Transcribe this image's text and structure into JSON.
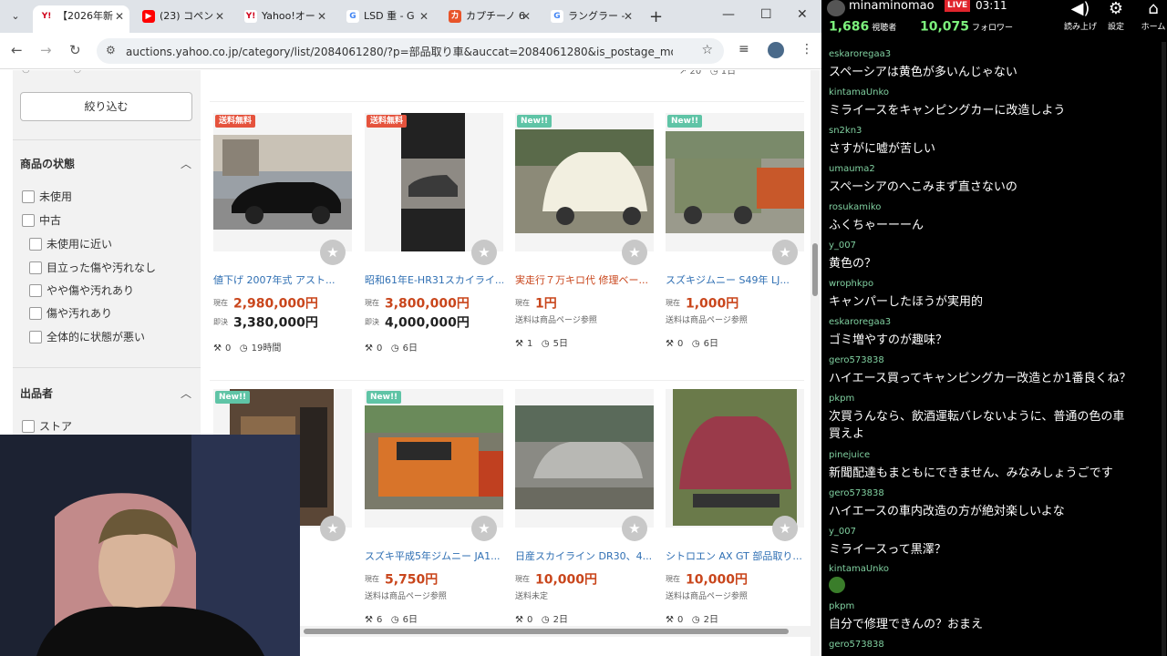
{
  "browser": {
    "tabs": [
      {
        "label": "【2026年新",
        "favicon": "Y!",
        "color": "#d0021b",
        "active": true
      },
      {
        "label": "(23) コペン",
        "favicon": "▶",
        "color": "#ff0000",
        "active": false
      },
      {
        "label": "Yahoo!オー",
        "favicon": "Y!",
        "color": "#d0021b",
        "active": false
      },
      {
        "label": "LSD 重 - G",
        "favicon": "G",
        "color": "#4285f4",
        "active": false
      },
      {
        "label": "カプチーノ 6",
        "favicon": "カ",
        "color": "#e8542a",
        "active": false
      },
      {
        "label": "ラングラー -",
        "favicon": "G",
        "color": "#4285f4",
        "active": false
      }
    ],
    "url": "auctions.yahoo.co.jp/category/list/2084061280/?p=部品取り車&auccat=2084061280&is_postage_mode=1&de..."
  },
  "sidebar": {
    "narrow_button": "絞り込む",
    "condition_title": "商品の状態",
    "conditions": [
      "未使用",
      "中古",
      "未使用に近い",
      "目立った傷や汚れなし",
      "やや傷や汚れあり",
      "傷や汚れあり",
      "全体的に状態が悪い"
    ],
    "seller_title": "出品者",
    "sellers": [
      "ストア"
    ]
  },
  "listings": [
    {
      "badge": "送料無料",
      "title": "値下げ 2007年式 アスト...",
      "current_label": "現在",
      "current": "2,980,000円",
      "bin_label": "即決",
      "bin": "3,380,000円",
      "shipping": "",
      "bids": "0",
      "time": "19時間"
    },
    {
      "badge": "送料無料",
      "title": "昭和61年E-HR31スカイライ...",
      "current_label": "現在",
      "current": "3,800,000円",
      "bin_label": "即決",
      "bin": "4,000,000円",
      "shipping": "",
      "bids": "0",
      "time": "6日"
    },
    {
      "badge": "New!!",
      "title": "実走行７万キロ代 修理ベー...",
      "current_label": "現在",
      "current": "1円",
      "bin_label": "",
      "bin": "",
      "shipping": "送料は商品ページ参照",
      "bids": "1",
      "time": "5日"
    },
    {
      "badge": "New!!",
      "title": "スズキジムニー S49年 LJ...",
      "current_label": "現在",
      "current": "1,000円",
      "bin_label": "",
      "bin": "",
      "shipping": "送料は商品ページ参照",
      "bids": "0",
      "time": "6日"
    },
    {
      "badge": "New!!",
      "title": "",
      "current_label": "",
      "current": "",
      "bin_label": "",
      "bin": "",
      "shipping": "",
      "bids": "",
      "time": ""
    },
    {
      "badge": "New!!",
      "title": "スズキ平成5年ジムニー JA1...",
      "current_label": "現在",
      "current": "5,750円",
      "bin_label": "",
      "bin": "",
      "shipping": "送料は商品ページ参照",
      "bids": "6",
      "time": "6日"
    },
    {
      "badge": "",
      "title": "日産スカイライン DR30、4...",
      "current_label": "現在",
      "current": "10,000円",
      "bin_label": "",
      "bin": "",
      "shipping": "送料未定",
      "bids": "0",
      "time": "2日"
    },
    {
      "badge": "",
      "title": "シトロエン AX GT 部品取り...",
      "current_label": "現在",
      "current": "10,000円",
      "bin_label": "",
      "bin": "",
      "shipping": "送料は商品ページ参照",
      "bids": "0",
      "time": "2日"
    }
  ],
  "stream": {
    "channel": "minaminomao",
    "live": "LIVE",
    "time": "03:11",
    "viewers": "1,686",
    "viewers_label": "視聴者",
    "followers": "10,075",
    "followers_label": "フォロワー",
    "tools": [
      {
        "icon": "speaker-icon",
        "label": "読み上げ"
      },
      {
        "icon": "gear-icon",
        "label": "設定"
      },
      {
        "icon": "home-icon",
        "label": "ホーム"
      }
    ]
  },
  "chat": [
    {
      "user": "eskaroregaa3",
      "text": "スペーシアは黄色が多いんじゃない"
    },
    {
      "user": "kintamaUnko",
      "text": "ミライースをキャンピングカーに改造しよう"
    },
    {
      "user": "sn2kn3",
      "text": "さすがに嘘が苦しい"
    },
    {
      "user": "umauma2",
      "text": "スペーシアのへこみまず直さないの"
    },
    {
      "user": "rosukamiko",
      "text": "ふくちゃーーーん"
    },
    {
      "user": "y_007",
      "text": "黄色の？"
    },
    {
      "user": "wrophkpo",
      "text": "キャンパーしたほうが実用的"
    },
    {
      "user": "eskaroregaa3",
      "text": "ゴミ増やすのが趣味？"
    },
    {
      "user": "gero573838",
      "text": "ハイエース買ってキャンピングカー改造とか1番良くね？"
    },
    {
      "user": "pkpm",
      "text": "次買うんなら、飲酒運転バレないように、普通の色の車",
      "text2": "買えよ"
    },
    {
      "user": "pinejuice",
      "text": "新聞配達もまともにできません、みなみしょうごです"
    },
    {
      "user": "gero573838",
      "text": "ハイエースの車内改造の方が絶対楽しいよな"
    },
    {
      "user": "y_007",
      "text": "ミライースって黒澤？"
    },
    {
      "user": "kintamaUnko",
      "text": "",
      "emoji": true
    },
    {
      "user": "pkpm",
      "text": "自分で修理できんの？おまえ"
    },
    {
      "user": "gero573838",
      "text": ""
    }
  ]
}
